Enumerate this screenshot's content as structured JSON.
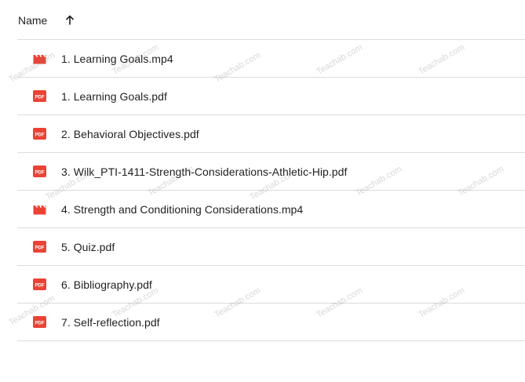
{
  "header": {
    "name_label": "Name",
    "sort_icon": "arrow-up-icon"
  },
  "files": [
    {
      "name": "1. Learning Goals.mp4",
      "icon": "video-file-icon"
    },
    {
      "name": "1. Learning Goals.pdf",
      "icon": "pdf-file-icon"
    },
    {
      "name": "2. Behavioral Objectives.pdf",
      "icon": "pdf-file-icon"
    },
    {
      "name": "3. Wilk_PTI-1411-Strength-Considerations-Athletic-Hip.pdf",
      "icon": "pdf-file-icon"
    },
    {
      "name": "4. Strength and Conditioning Considerations.mp4",
      "icon": "video-file-icon"
    },
    {
      "name": "5. Quiz.pdf",
      "icon": "pdf-file-icon"
    },
    {
      "name": "6. Bibliography.pdf",
      "icon": "pdf-file-icon"
    },
    {
      "name": "7. Self-reflection.pdf",
      "icon": "pdf-file-icon"
    }
  ],
  "pdf_icon_text": "PDF",
  "watermark": "Teachab.com",
  "colors": {
    "file_icon_red": "#ea4335",
    "divider": "#dadce0",
    "text": "#1f1f1f"
  }
}
